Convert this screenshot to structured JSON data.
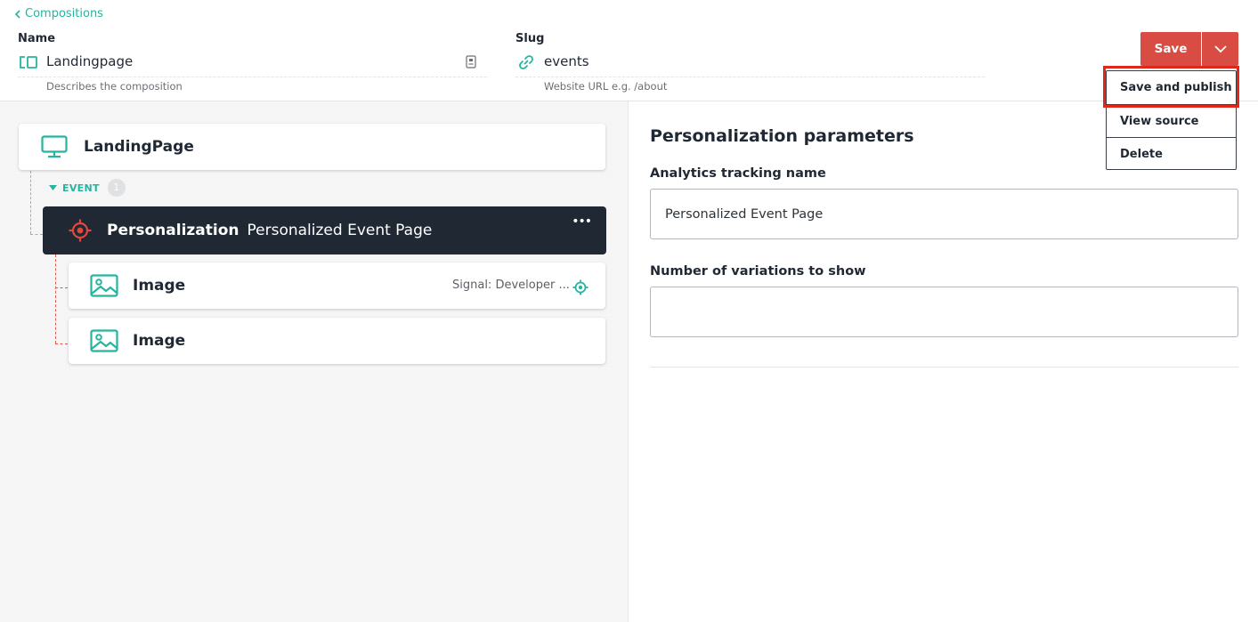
{
  "nav": {
    "back_label": "Compositions"
  },
  "fields": {
    "name": {
      "label": "Name",
      "value": "Landingpage",
      "help": "Describes the composition"
    },
    "slug": {
      "label": "Slug",
      "value": "events",
      "help": "Website URL e.g. /about"
    }
  },
  "actions": {
    "save_label": "Save",
    "menu": [
      "Save and publish",
      "View source",
      "Delete"
    ]
  },
  "tree": {
    "root": {
      "title": "LandingPage"
    },
    "slot": {
      "name": "EVENT",
      "count": "1"
    },
    "personalization": {
      "type": "Personalization",
      "name": "Personalized Event Page",
      "more": "•••"
    },
    "children": [
      {
        "title": "Image",
        "signal": "Signal: Developer ..."
      },
      {
        "title": "Image"
      }
    ]
  },
  "panel": {
    "title": "Personalization parameters",
    "tracking": {
      "label": "Analytics tracking name",
      "value": "Personalized Event Page"
    },
    "variations": {
      "label": "Number of variations to show",
      "value": ""
    }
  },
  "colors": {
    "accent": "#25b59e",
    "danger": "#d94c43",
    "dark": "#1f2833",
    "highlight": "#e1261c"
  }
}
